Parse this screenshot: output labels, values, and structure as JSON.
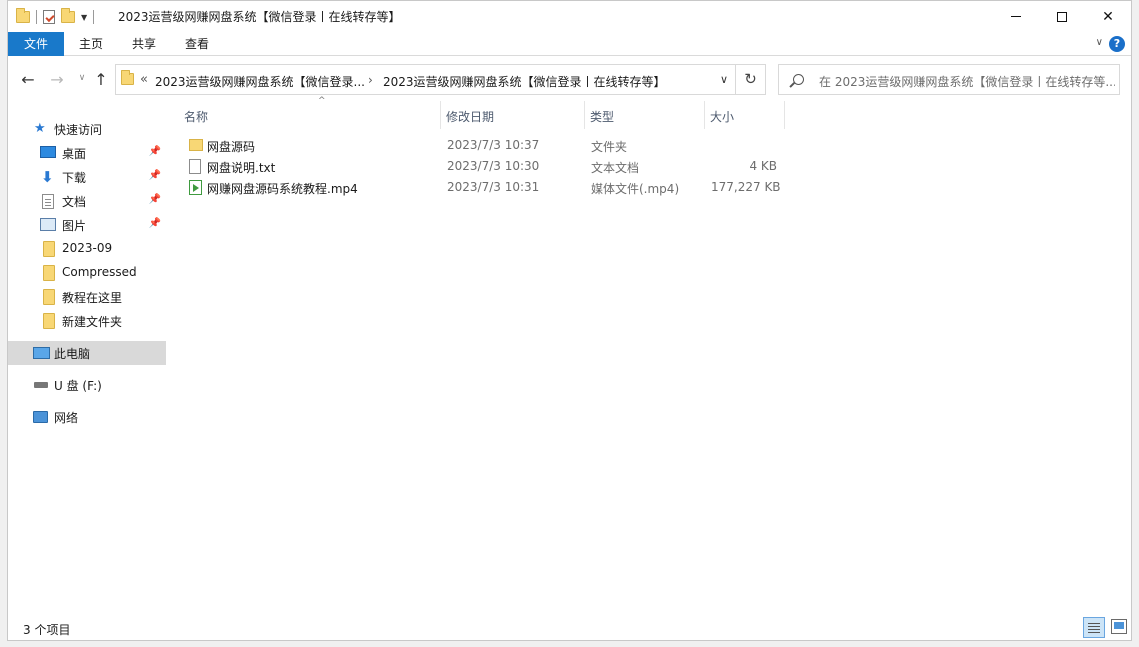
{
  "window": {
    "title": "2023运营级网赚网盘系统【微信登录丨在线转存等】"
  },
  "ribbon": {
    "tabs": [
      {
        "label": "文件"
      },
      {
        "label": "主页"
      },
      {
        "label": "共享"
      },
      {
        "label": "查看"
      }
    ],
    "help": "?"
  },
  "nav": {
    "back": "←",
    "forward": "→",
    "recent": "∨",
    "up": "↑",
    "address": {
      "overflow": "«",
      "crumbs": [
        "2023运营级网赚网盘系统【微信登录...",
        "2023运营级网赚网盘系统【微信登录丨在线转存等】"
      ],
      "separator": "›",
      "dropdown": "∨"
    },
    "refresh": "↻",
    "search_placeholder": "在 2023运营级网赚网盘系统【微信登录丨在线转存等..."
  },
  "sidebar": {
    "items": [
      {
        "label": "快速访问",
        "icon": "star-icon"
      },
      {
        "label": "桌面",
        "icon": "desktop-icon",
        "pinned": true
      },
      {
        "label": "下载",
        "icon": "download-icon",
        "pinned": true
      },
      {
        "label": "文档",
        "icon": "document-icon",
        "pinned": true
      },
      {
        "label": "图片",
        "icon": "picture-icon",
        "pinned": true
      },
      {
        "label": "2023-09",
        "icon": "folder-icon"
      },
      {
        "label": "Compressed",
        "icon": "folder-icon"
      },
      {
        "label": "教程在这里",
        "icon": "folder-icon"
      },
      {
        "label": "新建文件夹",
        "icon": "folder-icon"
      },
      {
        "label": "此电脑",
        "icon": "computer-icon",
        "selected": true
      },
      {
        "label": "U 盘 (F:)",
        "icon": "drive-icon"
      },
      {
        "label": "网络",
        "icon": "network-icon"
      }
    ],
    "pin_glyph": "📌"
  },
  "columns": {
    "name": "名称",
    "date": "修改日期",
    "type": "类型",
    "size": "大小",
    "sort_glyph": "^"
  },
  "files": [
    {
      "name": "网盘源码",
      "date": "2023/7/3 10:37",
      "type": "文件夹",
      "size": "",
      "icon": "folder-icon"
    },
    {
      "name": "网盘说明.txt",
      "date": "2023/7/3 10:30",
      "type": "文本文档",
      "size": "4 KB",
      "icon": "text-file-icon"
    },
    {
      "name": "网赚网盘源码系统教程.mp4",
      "date": "2023/7/3 10:31",
      "type": "媒体文件(.mp4)",
      "size": "177,227 KB",
      "icon": "video-file-icon"
    }
  ],
  "status": {
    "item_count": "3 个项目"
  }
}
